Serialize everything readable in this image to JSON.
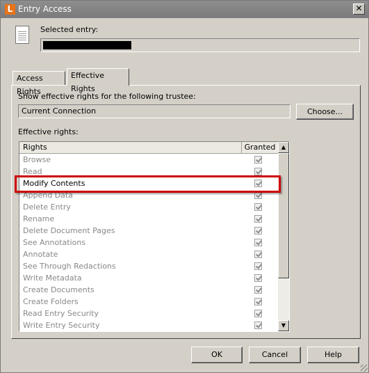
{
  "window": {
    "title": "Entry Access",
    "app_icon_letter": "L",
    "close_symbol": "✕"
  },
  "selected_entry": {
    "label": "Selected entry:",
    "value_redacted": true
  },
  "tabs": [
    {
      "label": "Access Rights",
      "active": false
    },
    {
      "label": "Effective Rights",
      "active": true
    }
  ],
  "trustee": {
    "label": "Show effective rights for the following trustee:",
    "value": "Current Connection",
    "choose_button": "Choose..."
  },
  "effective_rights": {
    "label": "Effective rights:",
    "columns": [
      "Rights",
      "Granted"
    ],
    "rows": [
      {
        "name": "Browse",
        "granted": true
      },
      {
        "name": "Read",
        "granted": true
      },
      {
        "name": "Modify Contents",
        "granted": true,
        "highlighted": true
      },
      {
        "name": "Append Data",
        "granted": true
      },
      {
        "name": "Delete Entry",
        "granted": true
      },
      {
        "name": "Rename",
        "granted": true
      },
      {
        "name": "Delete Document Pages",
        "granted": true
      },
      {
        "name": "See Annotations",
        "granted": true
      },
      {
        "name": "Annotate",
        "granted": true
      },
      {
        "name": "See Through Redactions",
        "granted": true
      },
      {
        "name": "Write Metadata",
        "granted": true
      },
      {
        "name": "Create Documents",
        "granted": true
      },
      {
        "name": "Create Folders",
        "granted": true
      },
      {
        "name": "Read Entry Security",
        "granted": true
      },
      {
        "name": "Write Entry Security",
        "granted": true
      }
    ]
  },
  "buttons": {
    "ok": "OK",
    "cancel": "Cancel",
    "help": "Help"
  },
  "colors": {
    "highlight": "#cc0000",
    "app_icon": "#e8731a"
  }
}
